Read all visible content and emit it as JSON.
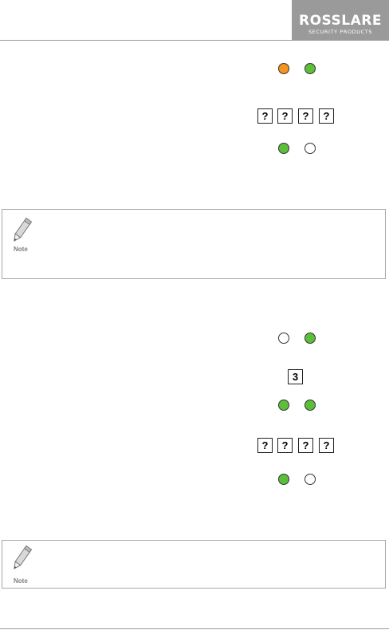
{
  "header": {
    "logo_main": "ROSSLARE",
    "logo_sub": "SECURITY PRODUCTS"
  },
  "colors": {
    "led_orange": "#f7931e",
    "led_green": "#5cbf3a",
    "led_off": "#ffffff",
    "rule_gray": "#9a9a9a"
  },
  "section1": {
    "keypad_code": [
      "?",
      "?",
      "?",
      "?"
    ]
  },
  "note1": {
    "label": "Note",
    "icon": "pencil-icon"
  },
  "section2": {
    "key_single": "3",
    "keypad_code": [
      "?",
      "?",
      "?",
      "?"
    ]
  },
  "note2": {
    "label": "Note",
    "icon": "pencil-icon"
  }
}
